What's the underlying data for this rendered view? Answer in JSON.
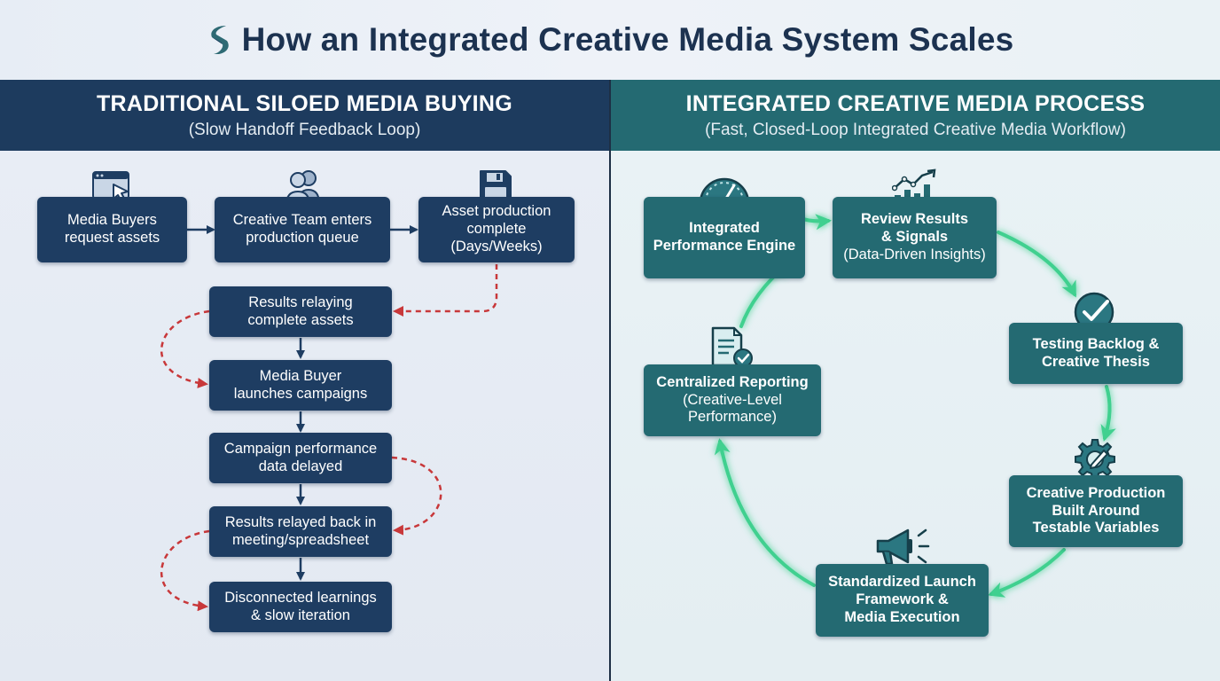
{
  "header": {
    "title": "How an Integrated Creative Media System Scales",
    "logo_icon": "s-logo-icon"
  },
  "left": {
    "title": "TRADITIONAL SILOED MEDIA BUYING",
    "subtitle": "(Slow Handoff Feedback Loop)",
    "steps": [
      {
        "line1": "Media Buyers",
        "line2": "request assets",
        "icon": "browser-cursor-icon"
      },
      {
        "line1": "Creative Team enters",
        "line2": "production queue",
        "icon": "people-icon"
      },
      {
        "line1": "Asset production",
        "line2": "complete",
        "line3": "(Days/Weeks)",
        "icon": "floppy-disk-icon"
      },
      {
        "line1": "Results relaying",
        "line2": "complete assets"
      },
      {
        "line1": "Media Buyer",
        "line2": "launches campaigns"
      },
      {
        "line1": "Campaign performance",
        "line2": "data delayed"
      },
      {
        "line1": "Results relayed back in",
        "line2": "meeting/spreadsheet"
      },
      {
        "line1": "Disconnected learnings",
        "line2": "& slow iteration"
      }
    ]
  },
  "right": {
    "title": "INTEGRATED CREATIVE MEDIA PROCESS",
    "subtitle": "(Fast, Closed-Loop Integrated Creative Media Workflow)",
    "nodes": [
      {
        "line1": "Integrated",
        "line2": "Performance Engine",
        "icon": "gauge-icon"
      },
      {
        "line1": "Review Results",
        "line2": "& Signals",
        "line3": "(Data-Driven Insights)",
        "icon": "bar-chart-trend-icon"
      },
      {
        "line1": "Testing Backlog &",
        "line2": "Creative Thesis",
        "icon": "check-circle-icon"
      },
      {
        "line1": "Creative Production",
        "line2": "Built Around",
        "line3": "Testable Variables",
        "icon": "gear-pencil-icon"
      },
      {
        "line1": "Standardized Launch",
        "line2": "Framework &",
        "line3": "Media Execution",
        "icon": "megaphone-icon"
      },
      {
        "line1": "Centralized Reporting",
        "line2": "(Creative-Level",
        "line3": "Performance)",
        "icon": "document-check-icon"
      }
    ]
  },
  "colors": {
    "navy": "#1e3d62",
    "teal": "#246a72",
    "dashed_red": "#c8383a",
    "loop_green": "#3fd08f",
    "divider": "#1d2f45"
  }
}
